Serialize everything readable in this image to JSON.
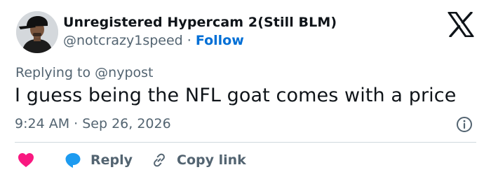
{
  "tweet": {
    "author": {
      "display_name": "Unregistered Hypercam 2(Still BLM)",
      "handle": "@notcrazy1speed",
      "separator": "·",
      "follow_label": "Follow"
    },
    "reply_context": "Replying to @nypost",
    "text": "I guess being the NFL goat comes with a price",
    "timestamp": "9:24 AM · Sep 26, 2026",
    "actions": {
      "like_icon": "heart-icon",
      "reply_icon": "speech-bubble-icon",
      "reply_label": "Reply",
      "copy_icon": "link-icon",
      "copy_label": "Copy link"
    },
    "brand_icon": "x-logo-icon",
    "info_icon": "info-icon"
  },
  "colors": {
    "text_primary": "#0f1419",
    "text_secondary": "#536471",
    "follow": "#006fd6",
    "like": "#f91880",
    "reply_bubble": "#1d9bf0",
    "divider": "#cfd9de"
  }
}
